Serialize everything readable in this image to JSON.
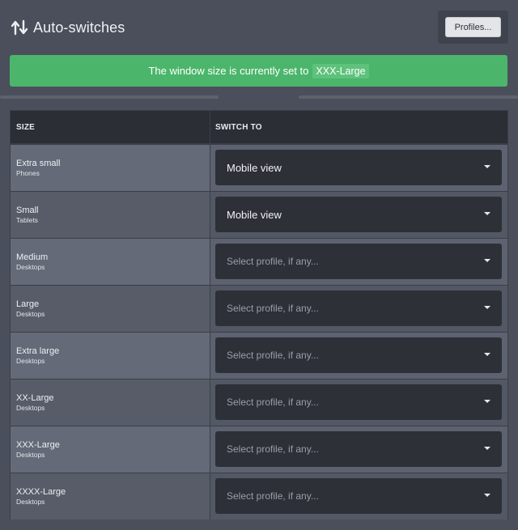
{
  "header": {
    "title": "Auto-switches",
    "icon": "switch-arrows-icon",
    "profiles_button": "Profiles..."
  },
  "banner": {
    "text": "The window size is currently set to",
    "current_size": "XXX-Large",
    "color": "#4bb66b"
  },
  "table": {
    "col_size": "SIZE",
    "col_switch": "SWITCH TO",
    "rows": [
      {
        "size": "Extra small",
        "device": "Phones",
        "value": "Mobile view"
      },
      {
        "size": "Small",
        "device": "Tablets",
        "value": "Mobile view"
      },
      {
        "size": "Medium",
        "device": "Desktops",
        "value": "Select profile, if any..."
      },
      {
        "size": "Large",
        "device": "Desktops",
        "value": "Select profile, if any..."
      },
      {
        "size": "Extra large",
        "device": "Desktops",
        "value": "Select profile, if any..."
      },
      {
        "size": "XX-Large",
        "device": "Desktops",
        "value": "Select profile, if any..."
      },
      {
        "size": "XXX-Large",
        "device": "Desktops",
        "value": "Select profile, if any..."
      },
      {
        "size": "XXXX-Large",
        "device": "Desktops",
        "value": "Select profile, if any..."
      }
    ]
  }
}
